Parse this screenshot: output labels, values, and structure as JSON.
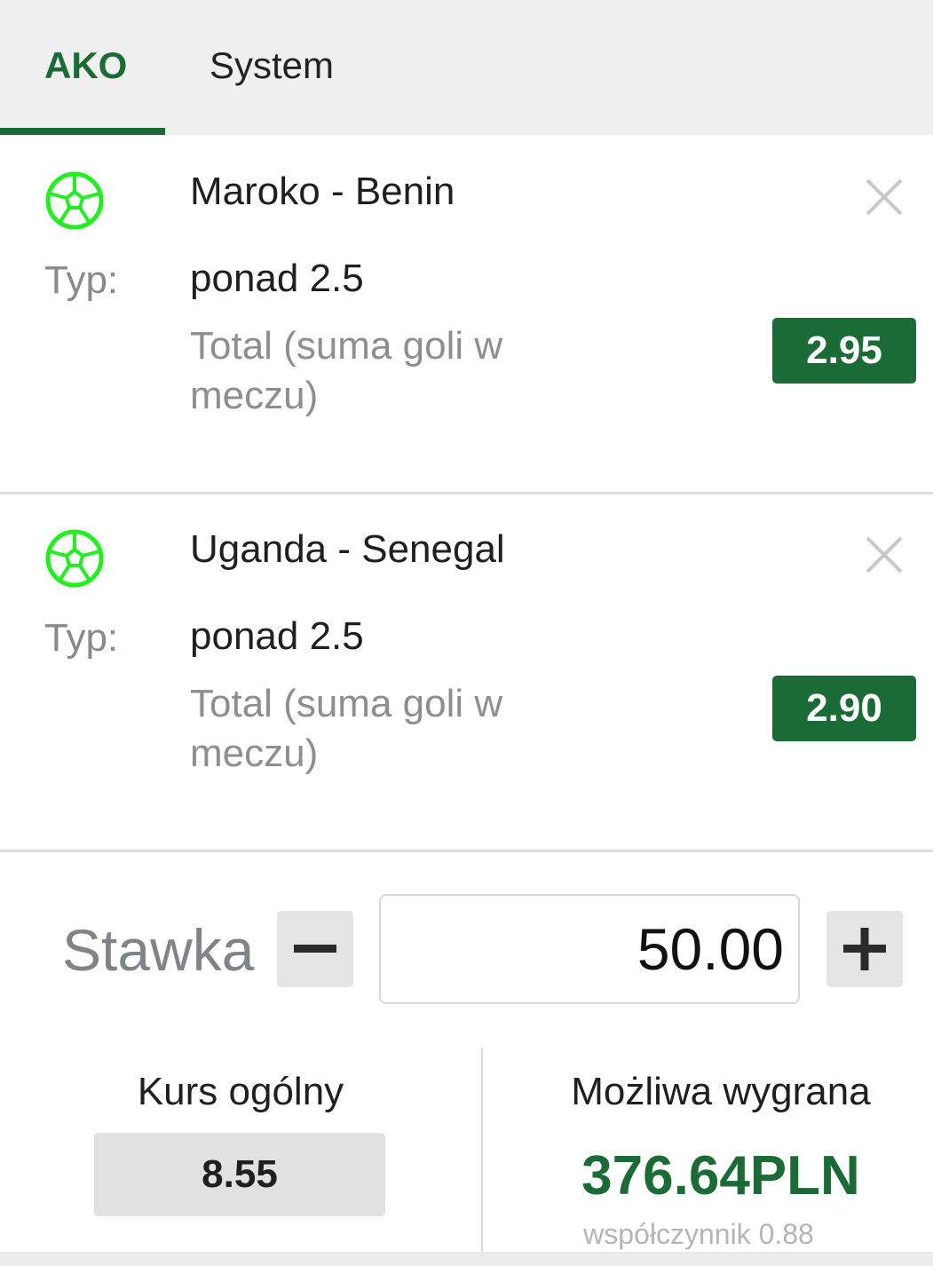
{
  "tabs": [
    {
      "label": "AKO",
      "active": true
    },
    {
      "label": "System",
      "active": false
    }
  ],
  "bets": [
    {
      "sport_icon": "soccer-ball-icon",
      "match": "Maroko - Benin",
      "type_label": "Typ:",
      "selection": "ponad 2.5",
      "market": "Total (suma goli w meczu)",
      "odds": "2.95"
    },
    {
      "sport_icon": "soccer-ball-icon",
      "match": "Uganda - Senegal",
      "type_label": "Typ:",
      "selection": "ponad 2.5",
      "market": "Total (suma goli w meczu)",
      "odds": "2.90"
    }
  ],
  "stake": {
    "label": "Stawka",
    "value": "50.00"
  },
  "summary": {
    "total_odds_label": "Kurs ogólny",
    "total_odds": "8.55",
    "win_label": "Możliwa wygrana",
    "win_amount": "376.64PLN",
    "coefficient": "współczynnik 0.88"
  },
  "colors": {
    "accent": "#1a6b35",
    "icon_green": "#22ee22",
    "tab_bar_bg": "#efefef"
  }
}
